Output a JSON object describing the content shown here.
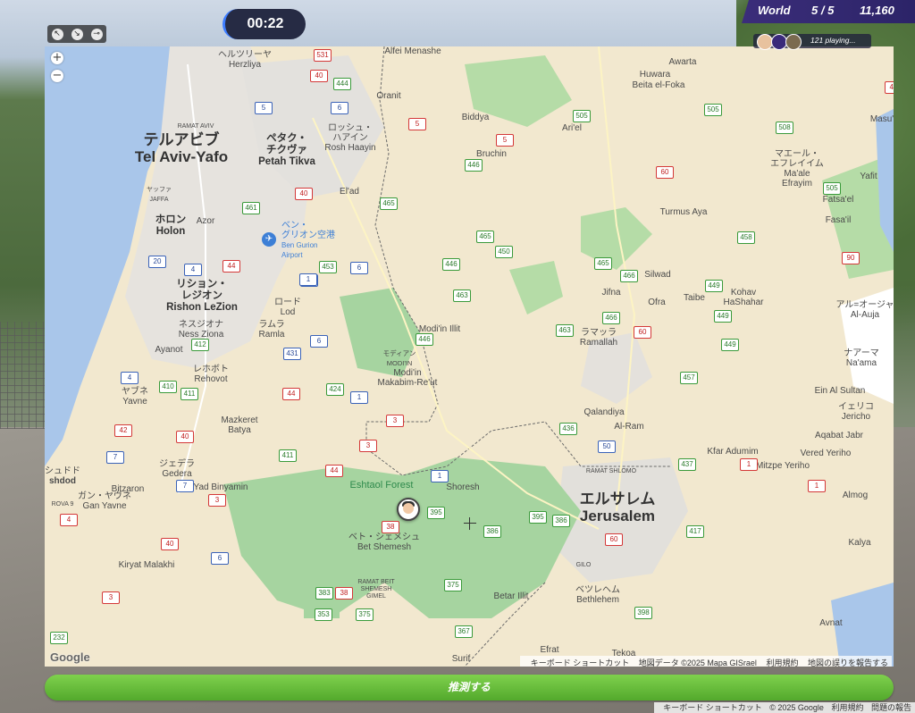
{
  "timer": "00:22",
  "scoreboard": {
    "mode": "World",
    "round": "5 / 5",
    "score": "11,160"
  },
  "players": {
    "text": "121 playing..."
  },
  "tools": {
    "icons": [
      "pointer-icon",
      "arrow-icon",
      "pin-icon"
    ]
  },
  "map": {
    "zoom_in": "+",
    "zoom_out": "−",
    "logo": "Google",
    "attribution": {
      "shortcuts": "キーボード ショートカット",
      "map_data": "地図データ ©2025 Mapa GISrael",
      "terms": "利用規約",
      "report": "地図の誤りを報告する"
    },
    "labels": {
      "herzliya_jp": "ヘルツリーヤ",
      "herzliya": "Herzliya",
      "alfei": "Alfei Menashe",
      "awarta": "Awarta",
      "huwara": "Huwara",
      "beita": "Beita el-Foka",
      "oranit": "Oranit",
      "biddya": "Biddya",
      "arie": "Ari'el",
      "ramat_aviv": "RAMAT AVIV",
      "tlv_jp": "テルアビブ",
      "tlv": "Tel Aviv-Yafo",
      "petah_jp1": "ペタク・",
      "petah_jp2": "チクヴァ",
      "petah": "Petah Tikva",
      "rosh_jp1": "ロッシュ・",
      "rosh_jp2": "ハアイン",
      "rosh": "Rosh Haayin",
      "bruchin": "Bruchin",
      "maale_jp1": "マエール・",
      "maale_jp2": "エフレイイム",
      "maale1": "Ma'ale",
      "maale2": "Efrayim",
      "yafit": "Yafit",
      "masu": "Masu'",
      "jaffa_jp": "ヤッファ",
      "jaffa": "JAFFA",
      "elad": "El'ad",
      "fatsael": "Fatsa'el",
      "fasail": "Fasa'il",
      "holon_jp": "ホロン",
      "holon": "Holon",
      "azor": "Azor",
      "airport_jp1": "ベン・",
      "airport_jp2": "グリオン空港",
      "airport1": "Ben Gurion",
      "airport2": "Airport",
      "turmus": "Turmus Aya",
      "rishon_jp1": "リション・",
      "rishon_jp2": "レジオン",
      "rishon": "Rishon LeZion",
      "lod_jp": "ロード",
      "lod": "Lod",
      "silwad": "Silwad",
      "jifna": "Jifna",
      "ofra": "Ofra",
      "taibe": "Taibe",
      "kohav1": "Kohav",
      "kohav2": "HaShahar",
      "auja_jp": "アル=オージャ",
      "auja": "Al-Auja",
      "ness_jp": "ネスジオナ",
      "ness": "Ness Ziona",
      "ramla_jp": "ラムラ",
      "ramla": "Ramla",
      "modiin_illit": "Modi'in Illit",
      "ramallah_jp": "ラマッラ",
      "ramallah": "Ramallah",
      "naama_jp": "ナアーマ",
      "naama": "Na'ama",
      "ayanot": "Ayanot",
      "modiin_jp": "モディアン",
      "modiin_caps": "MODI'IN",
      "modiin1": "Modi'in",
      "modiin2": "Makabim-Re'ut",
      "rehovot_jp": "レホボト",
      "rehovot": "Rehovot",
      "yavne_jp": "ヤブネ",
      "yavne": "Yavne",
      "ein_sultan": "Ein Al Sultan",
      "jericho_jp": "イェリコ",
      "jericho": "Jericho",
      "qalandiya": "Qalandiya",
      "mazkeret1": "Mazkeret",
      "mazkeret2": "Batya",
      "alram": "Al-Ram",
      "aqabat": "Aqabat Jabr",
      "kfar": "Kfar Adumim",
      "vered": "Vered Yeriho",
      "ashdod_jp": "シュドド",
      "ashdod": "shdod",
      "gedera_jp": "ジェデラ",
      "gedera": "Gedera",
      "ramat_shlomo": "RAMAT SHLOMO",
      "mitzpe": "Mitzpe Yeriho",
      "bitzaron": "Bitzaron",
      "ganyavne_jp": "ガン・ヤヴネ",
      "ganyavne": "Gan Yavne",
      "yad": "Yad Binyamin",
      "eshtaol": "Eshtaol Forest",
      "shoresh": "Shoresh",
      "jerusalem_jp": "エルサレム",
      "jerusalem": "Jerusalem",
      "almog": "Almog",
      "rova": "ROVA 9",
      "betshemesh_jp": "ベト・シェメシュ",
      "betshemesh": "Bet Shemesh",
      "kalya": "Kalya",
      "kiryat": "Kiryat Malakhi",
      "gilo": "GILO",
      "rbs1": "RAMAT BEIT",
      "rbs2": "SHEMESH",
      "rbs3": "GIMEL",
      "betar": "Betar Illit",
      "bethlehem_jp": "ベツレヘム",
      "bethlehem": "Bethlehem",
      "avnat": "Avnat",
      "efrat": "Efrat",
      "tekoa": "Tekoa",
      "surif": "Surif"
    },
    "routes": [
      "531",
      "40",
      "444",
      "5",
      "6",
      "5",
      "505",
      "505",
      "508",
      "446",
      "5",
      "40",
      "60",
      "505",
      "461",
      "40",
      "465",
      "4",
      "458",
      "465",
      "450",
      "446",
      "20",
      "44",
      "453",
      "6",
      "4",
      "465",
      "466",
      "1",
      "449",
      "90",
      "463",
      "466",
      "449",
      "449",
      "463",
      "60",
      "412",
      "431",
      "6",
      "446",
      "4",
      "410",
      "411",
      "424",
      "1",
      "44",
      "457",
      "3",
      "436",
      "50",
      "40",
      "42",
      "3",
      "411",
      "7",
      "44",
      "1",
      "437",
      "1",
      "7",
      "3",
      "395",
      "395",
      "386",
      "386",
      "4",
      "6",
      "40",
      "60",
      "417",
      "3",
      "383",
      "38",
      "353",
      "375",
      "375",
      "367",
      "398",
      "232",
      "38",
      "1"
    ]
  },
  "guess_button": "推測する",
  "bottom_attribution": {
    "shortcuts": "キーボード ショートカット",
    "copyright": "© 2025 Google",
    "terms": "利用規約",
    "report": "問題の報告"
  },
  "colors": {
    "sea": "#a9c6ea",
    "land": "#f2e8cf",
    "park": "#a6d4a0",
    "urban": "#e4e1dc",
    "timer_bg": "#262b44",
    "score_bg": "#2c2468",
    "guess_green": "#5cb336"
  }
}
